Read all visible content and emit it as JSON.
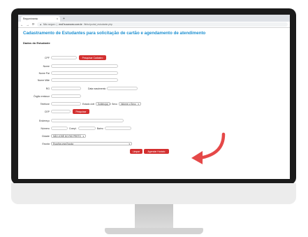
{
  "browser": {
    "tab_title": "Requerimento",
    "tab_close": "×",
    "new_tab": "+",
    "url_prefix": "Não seguro",
    "url_host": "end?a.sorocec.com.br",
    "url_path": "/finho/portal_estudante.php"
  },
  "page": {
    "title": "Cadastramento de Estudantes para solicitação de cartão e agendamento de atendimento",
    "section": "Dados do Estudante"
  },
  "form": {
    "cpf_label": "CPF",
    "search_cadastro": "Pesquisar Cadastro",
    "nome_label": "Nome",
    "nome_pai_label": "Nome Pai",
    "nome_mae_label": "Nome Mãe",
    "rg_label": "RG",
    "data_nasc_label": "Data nascimento",
    "orgao_label": "Órgão emissor",
    "telefone_label": "Telefone",
    "estado_civil_label": "Estado civil",
    "estado_civil_value": "Solteiro(a)",
    "sexo_label": "Sexo",
    "sexo_value": "Informe o Sexo",
    "cep_label": "CEP",
    "pesquisar": "Pesquisar",
    "endereco_label": "Endereço",
    "numero_label": "Número",
    "compl_label": "Compl.",
    "bairro_label": "Bairro",
    "cidade_label": "Cidade",
    "cidade_value": "SÃO JOSÉ DO RIO PRETO",
    "escola_label": "Escola",
    "escola_value": "Escolha uma Escola",
    "limpar": "Limpar",
    "agendar": "Agendar Horário"
  },
  "colors": {
    "accent": "#d32f2f",
    "title": "#1b8fd1"
  }
}
